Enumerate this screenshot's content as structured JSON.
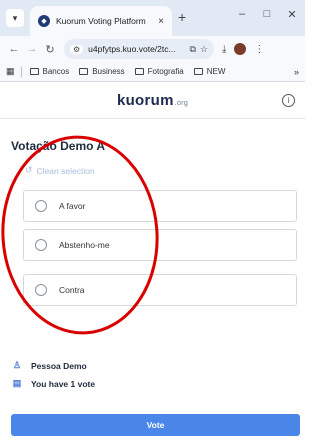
{
  "browser": {
    "tab_title": "Kuorum Voting Platform",
    "tab_close": "×",
    "new_tab": "+",
    "url": "u4pfytps.kuo.vote/2tc...",
    "bookmarks": [
      "Bancos",
      "Business",
      "Fotografia",
      "NEW"
    ],
    "more": "»"
  },
  "app": {
    "brand": "kuorum",
    "brand_suffix": ".org",
    "info": "i"
  },
  "poll": {
    "title": "Votação Demo A",
    "clean_label": "Clean selection",
    "options": [
      {
        "label": "A favor"
      },
      {
        "label": "Abstenho-me"
      },
      {
        "label": "Contra"
      }
    ]
  },
  "user": {
    "name": "Pessoa Demo",
    "votes": "You have 1 vote"
  },
  "actions": {
    "vote_label": "Vote"
  },
  "colors": {
    "accent": "#4a86e8",
    "annotation": "#d90000"
  }
}
